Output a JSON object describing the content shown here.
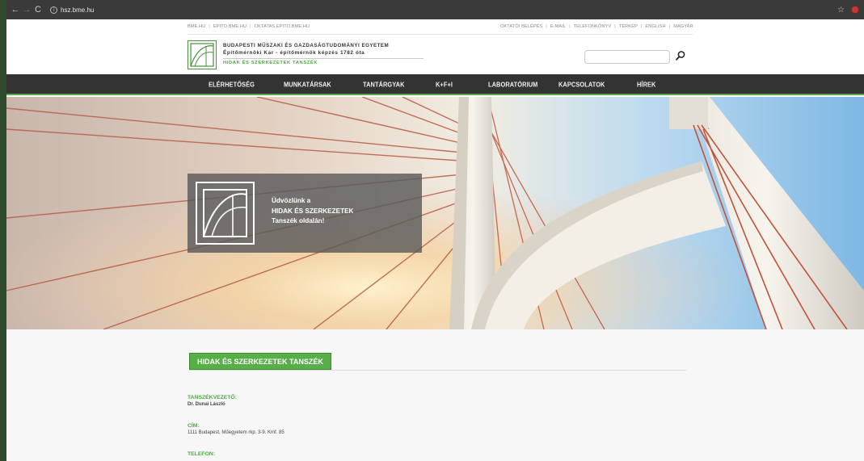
{
  "browser": {
    "url": "hsz.bme.hu"
  },
  "top_links": {
    "left": [
      "BME.HU",
      "EPITO.BME.HU",
      "OKTATAS.EPITO.BME.HU"
    ],
    "right": [
      "OKTATÓI BELÉPÉS",
      "E-MAIL",
      "TELEFONKÖNYV",
      "TÉRKÉP",
      "ENGLISH",
      "MAGYAR"
    ]
  },
  "header": {
    "university": "BUDAPESTI MŰSZAKI ÉS GAZDASÁGTUDOMÁNYI EGYETEM",
    "faculty": "Építőmérnöki Kar - építőmérnök képzés 1782 óta",
    "department": "HIDAK ÉS SZERKEZETEK TANSZÉK",
    "search_placeholder": ""
  },
  "nav": {
    "items": [
      "ELÉRHETŐSÉG",
      "MUNKATÁRSAK",
      "TANTÁRGYAK",
      "K+F+I",
      "LABORATÓRIUM",
      "KAPCSOLATOK",
      "HÍREK"
    ]
  },
  "hero": {
    "line1": "Üdvözlünk a",
    "line2": "HIDAK ÉS SZERKEZETEK",
    "line3": "Tanszék oldalán!"
  },
  "content": {
    "section_title": "HIDAK ÉS SZERKEZETEK TANSZÉK",
    "fields": [
      {
        "label": "TANSZÉKVEZETŐ:",
        "value": "Dr. Dunai László"
      },
      {
        "label": "CÍM:",
        "value": "1111 Budapest, Műegyetem rkp. 3-9. Kmf. 85"
      },
      {
        "label": "TELEFON:",
        "value": ""
      }
    ]
  },
  "colors": {
    "accent": "#56b047",
    "nav_bg": "#333333"
  }
}
